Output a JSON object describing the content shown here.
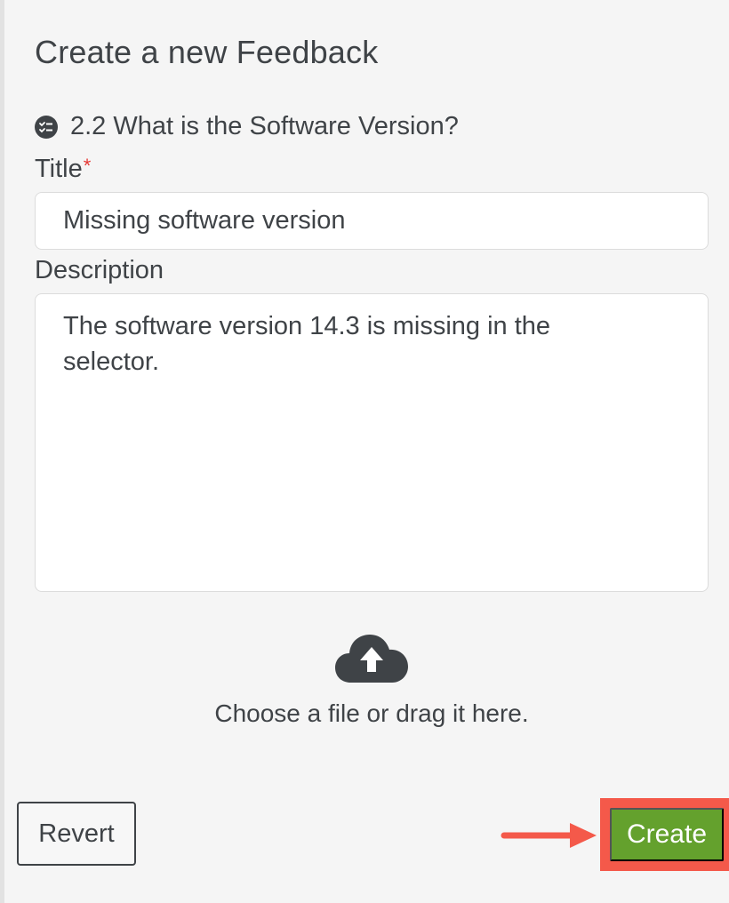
{
  "form": {
    "heading": "Create a new Feedback",
    "question": "2.2 What is the Software Version?",
    "title_label": "Title",
    "required_marker": "*",
    "title_value": "Missing software version",
    "description_label": "Description",
    "description_value": "The software version 14.3 is missing in the\nselector."
  },
  "upload": {
    "icon": "cloud-upload-icon",
    "text": "Choose a file or drag it here."
  },
  "actions": {
    "revert_label": "Revert",
    "create_label": "Create"
  },
  "colors": {
    "create_button": "#64a12d",
    "highlight": "#f4594a",
    "required": "#e53935",
    "text": "#3f4347"
  },
  "icons": {
    "question": "checklist-icon",
    "annotation": "arrow-right-icon"
  }
}
